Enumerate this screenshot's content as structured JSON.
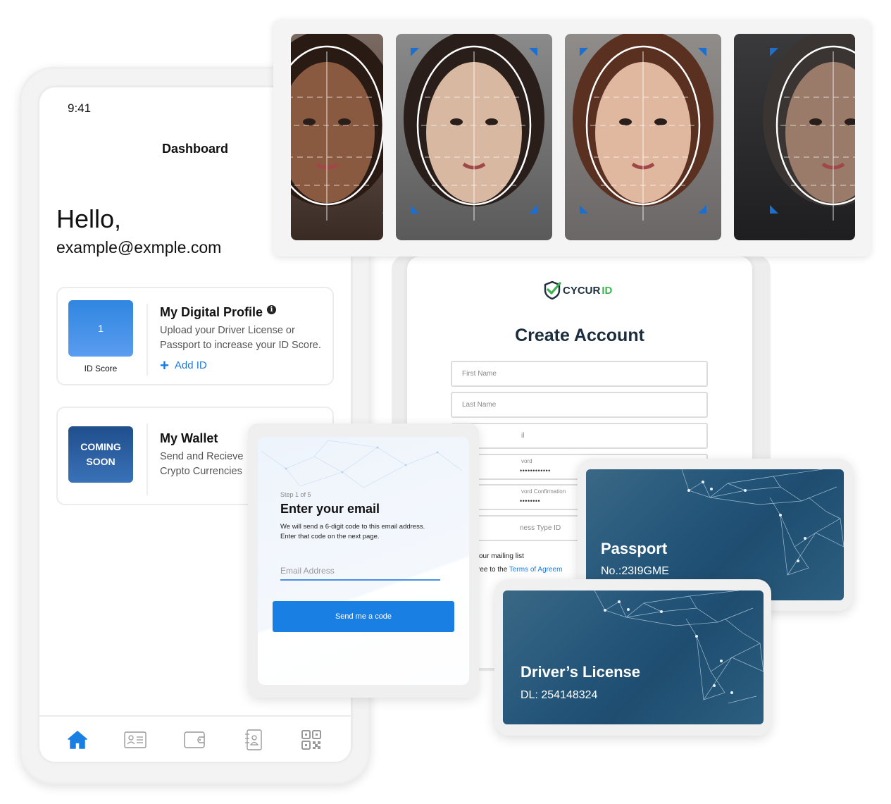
{
  "phone": {
    "status_time": "9:41",
    "screen_title": "Dashboard",
    "greeting": "Hello,",
    "user_email": "example@exmple.com",
    "profile_card": {
      "score_value": "1",
      "score_label": "ID Score",
      "title": "My Digital Profile",
      "info_icon": "i",
      "description": "Upload your Driver License or Passport to increase your ID Score.",
      "add_label": "Add ID",
      "add_icon": "+"
    },
    "wallet_card": {
      "badge_line1": "COMING",
      "badge_line2": "SOON",
      "title": "My Wallet",
      "description": "Send and Recieve Crypto Currencies"
    },
    "tabbar": [
      {
        "name": "home-icon",
        "active": true
      },
      {
        "name": "id-card-icon",
        "active": false
      },
      {
        "name": "wallet-icon",
        "active": false
      },
      {
        "name": "contacts-icon",
        "active": false
      },
      {
        "name": "qr-code-icon",
        "active": false
      }
    ]
  },
  "face_scans": [
    {
      "name": "face-scan-1"
    },
    {
      "name": "face-scan-2"
    },
    {
      "name": "face-scan-3"
    },
    {
      "name": "face-scan-4"
    }
  ],
  "signup": {
    "logo_dark": "CYCUR",
    "logo_green": "ID",
    "title": "Create Account",
    "fields": {
      "first_name": "First Name",
      "last_name": "Last Name",
      "email": "il",
      "password_label": "vord",
      "password_value": "••••••••••••",
      "password_confirm_label": "vord Confirmation",
      "password_confirm_value": "••••••••",
      "business_type": "ness Type ID"
    },
    "mailing_list": "our mailing list",
    "agree_prefix": "ree to the ",
    "agree_link": "Terms of Agreem"
  },
  "email_step": {
    "step": "Step 1 of 5",
    "title": "Enter your email",
    "description": "We will send a  6-digit code to this email address. Enter that code on the next page.",
    "placeholder": "Email Address",
    "button": "Send me a code"
  },
  "passport": {
    "title": "Passport",
    "number": "No.:23I9GME"
  },
  "drivers_license": {
    "title": "Driver’s License",
    "number": "DL: 254148324"
  },
  "colors": {
    "accent_blue": "#1a7fe3",
    "card_navy": "#24567a",
    "logo_green": "#3bb54a",
    "scan_corner": "#1a6fd0"
  }
}
